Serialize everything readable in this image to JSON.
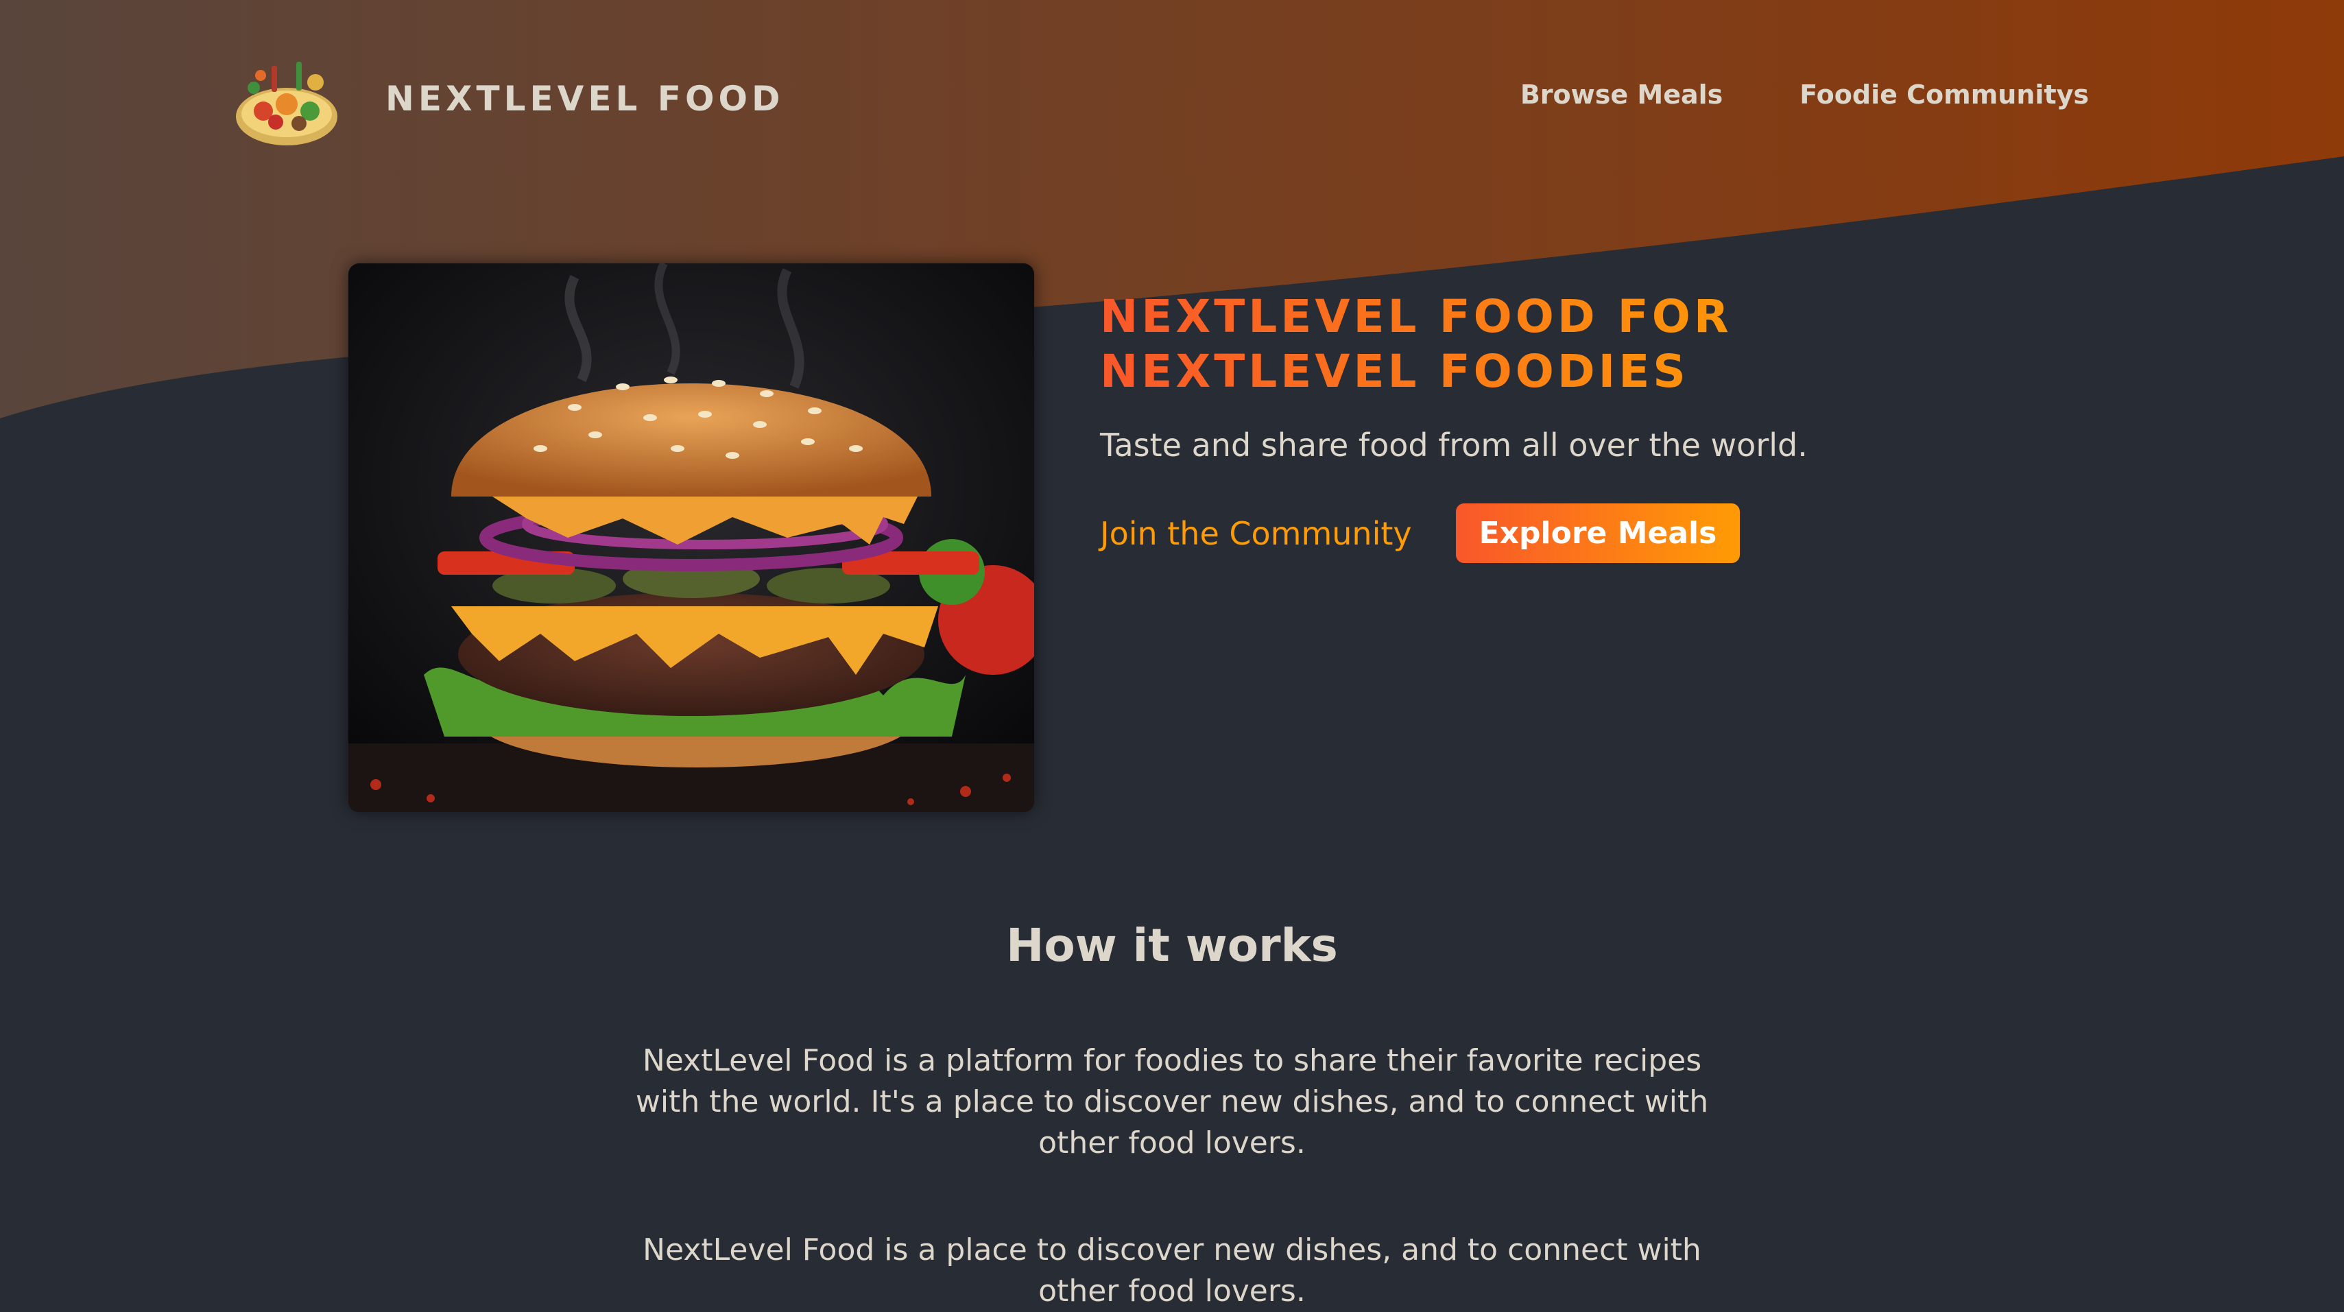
{
  "header": {
    "logo_text": "NEXTLEVEL FOOD",
    "logo_icon": "food-platter-logo",
    "nav": [
      {
        "label": "Browse Meals"
      },
      {
        "label": "Foodie Communitys"
      }
    ]
  },
  "hero": {
    "image_subject": "burger-image",
    "title": "NEXTLEVEL FOOD FOR NEXTLEVEL FOODIES",
    "subtitle": "Taste and share food from all over the world.",
    "community_link": "Join the Community",
    "explore_button": "Explore Meals"
  },
  "how_it_works": {
    "heading": "How it works",
    "paragraphs": [
      "NextLevel Food is a platform for foodies to share their favorite recipes with the world. It's a place to discover new dishes, and to connect with other food lovers.",
      "NextLevel Food is a place to discover new dishes, and to connect with other food lovers."
    ]
  },
  "colors": {
    "background": "#282c34",
    "accent_start": "#f9572a",
    "accent_end": "#ff9b05",
    "text": "#ddd6cb",
    "header_gradient_start": "#59453c",
    "header_gradient_end": "#8f3a09"
  }
}
